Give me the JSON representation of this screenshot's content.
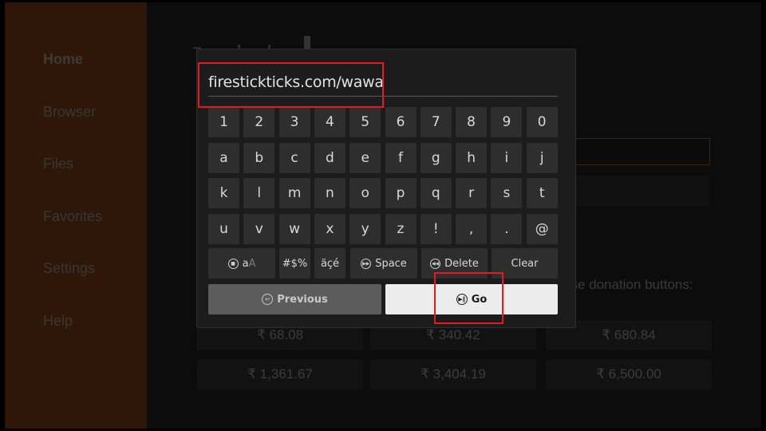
{
  "sidebar": {
    "items": [
      {
        "label": "Home",
        "active": true
      },
      {
        "label": "Browser",
        "active": false
      },
      {
        "label": "Files",
        "active": false
      },
      {
        "label": "Favorites",
        "active": false
      },
      {
        "label": "Settings",
        "active": false
      },
      {
        "label": "Help",
        "active": false
      }
    ]
  },
  "background": {
    "donation_text_line1": "ase donation buttons:",
    "donation_text_line2": ")",
    "donation_amounts": [
      "₹ 68.08",
      "₹ 340.42",
      "₹ 680.84",
      "₹ 1,361.67",
      "₹ 3,404.19",
      "₹ 6,500.00"
    ]
  },
  "keyboard": {
    "input_value": "firestickticks.com/wawa",
    "rows": [
      [
        "1",
        "2",
        "3",
        "4",
        "5",
        "6",
        "7",
        "8",
        "9",
        "0"
      ],
      [
        "a",
        "b",
        "c",
        "d",
        "e",
        "f",
        "g",
        "h",
        "i",
        "j"
      ],
      [
        "k",
        "l",
        "m",
        "n",
        "o",
        "p",
        "q",
        "r",
        "s",
        "t"
      ],
      [
        "u",
        "v",
        "w",
        "x",
        "y",
        "z",
        "!",
        ",",
        ".",
        "@"
      ]
    ],
    "function_keys": {
      "case_toggle": {
        "label_lower": "a",
        "label_upper": "A",
        "icon": "menu-button-icon"
      },
      "symbols": "#$%",
      "accents": "äçé",
      "space": {
        "label": "Space",
        "icon": "fast-forward-icon"
      },
      "delete": {
        "label": "Delete",
        "icon": "rewind-icon"
      },
      "clear": "Clear"
    },
    "previous": {
      "label": "Previous",
      "icon": "back-icon"
    },
    "go": {
      "label": "Go",
      "icon": "play-pause-icon"
    }
  },
  "colors": {
    "highlight": "#e21b23",
    "sidebar_bg": "#2e1709",
    "dialog_bg": "#1c1c1c",
    "key_bg": "#2e2e2e",
    "go_bg": "#ececec"
  }
}
